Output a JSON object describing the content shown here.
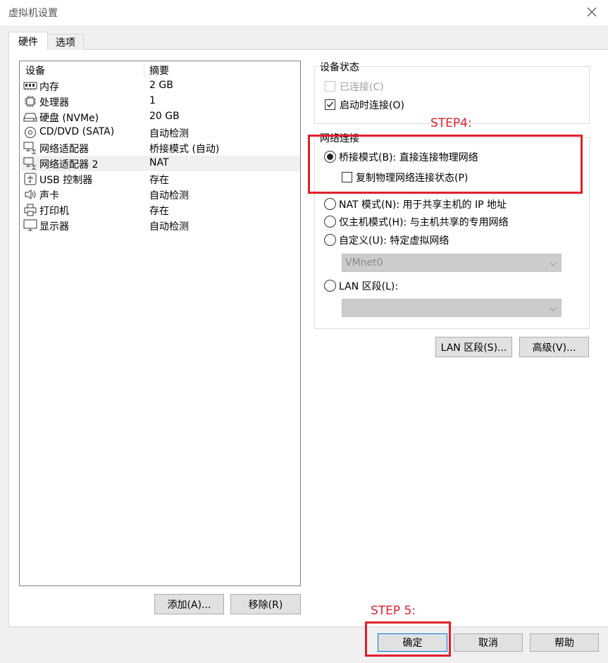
{
  "window": {
    "title": "虚拟机设置"
  },
  "tabs": [
    {
      "label": "硬件",
      "active": true
    },
    {
      "label": "选项",
      "active": false
    }
  ],
  "device_list": {
    "columns": [
      "设备",
      "摘要"
    ],
    "rows": [
      {
        "icon": "memory-icon",
        "name": "内存",
        "summary": "2 GB"
      },
      {
        "icon": "processor-icon",
        "name": "处理器",
        "summary": "1"
      },
      {
        "icon": "hard-disk-icon",
        "name": "硬盘 (NVMe)",
        "summary": "20 GB"
      },
      {
        "icon": "cd-dvd-icon",
        "name": "CD/DVD (SATA)",
        "summary": "自动检测"
      },
      {
        "icon": "network-adapter-icon",
        "name": "网络适配器",
        "summary": "桥接模式 (自动)"
      },
      {
        "icon": "network-adapter-icon",
        "name": "网络适配器 2",
        "summary": "NAT",
        "selected": true
      },
      {
        "icon": "usb-icon",
        "name": "USB 控制器",
        "summary": "存在"
      },
      {
        "icon": "sound-card-icon",
        "name": "声卡",
        "summary": "自动检测"
      },
      {
        "icon": "printer-icon",
        "name": "打印机",
        "summary": "存在"
      },
      {
        "icon": "display-icon",
        "name": "显示器",
        "summary": "自动检测"
      }
    ]
  },
  "list_buttons": {
    "add": "添加(A)...",
    "remove": "移除(R)"
  },
  "device_status": {
    "title": "设备状态",
    "connected": {
      "label": "已连接(C)",
      "checked": false,
      "enabled": false
    },
    "connect_at_power_on": {
      "label": "启动时连接(O)",
      "checked": true
    }
  },
  "network_connection": {
    "title": "网络连接",
    "bridged": {
      "label": "桥接模式(B): 直接连接物理网络",
      "selected": true
    },
    "replicate": {
      "label": "复制物理网络连接状态(P)",
      "checked": false
    },
    "nat": {
      "label": "NAT 模式(N): 用于共享主机的 IP 地址",
      "selected": false
    },
    "host_only": {
      "label": "仅主机模式(H): 与主机共享的专用网络",
      "selected": false
    },
    "custom": {
      "label": "自定义(U): 特定虚拟网络",
      "selected": false
    },
    "custom_value": "VMnet0",
    "lan_segment": {
      "label": "LAN 区段(L):",
      "selected": false
    },
    "lan_segment_value": ""
  },
  "network_buttons": {
    "lan_segments": "LAN 区段(S)...",
    "advanced": "高级(V)..."
  },
  "footer": {
    "ok": "确定",
    "cancel": "取消",
    "help": "帮助"
  },
  "annotations": {
    "step4": "STEP4:",
    "step5": "STEP 5:",
    "color": "#e0202e"
  }
}
